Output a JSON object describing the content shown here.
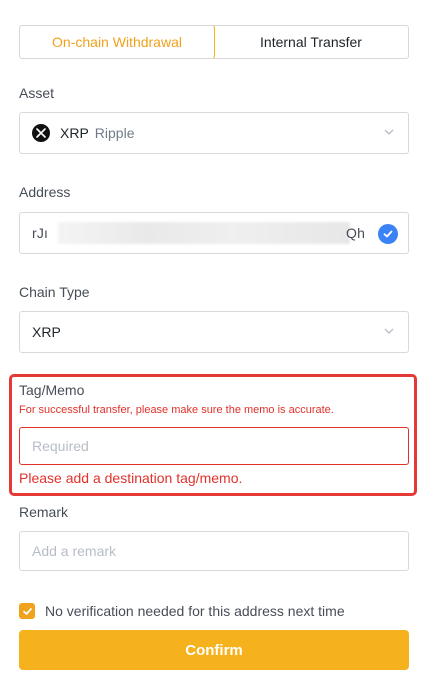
{
  "tabs": [
    {
      "label": "On-chain Withdrawal",
      "active": true
    },
    {
      "label": "Internal Transfer",
      "active": false
    }
  ],
  "asset": {
    "label": "Asset",
    "symbol": "XRP",
    "name": "Ripple",
    "icon": "xrp-coin-icon"
  },
  "address": {
    "label": "Address",
    "value": "rJh22APuA1709omowuAxAhDG0tkoapQh",
    "shown_start": "rJı",
    "shown_end": "Qh",
    "verified_icon": "check-circle-icon"
  },
  "chain": {
    "label": "Chain Type",
    "value": "XRP"
  },
  "memo": {
    "label": "Tag/Memo",
    "warning": "For successful transfer, please make sure the memo is accurate.",
    "placeholder": "Required",
    "error": "Please add a destination tag/memo."
  },
  "remark": {
    "label": "Remark",
    "placeholder": "Add a remark"
  },
  "checkbox": {
    "label": "No verification needed for this address next time",
    "checked": true
  },
  "confirm_label": "Confirm",
  "colors": {
    "accent": "#f0b90b",
    "error": "#e0322b",
    "button": "#f6b21d"
  }
}
